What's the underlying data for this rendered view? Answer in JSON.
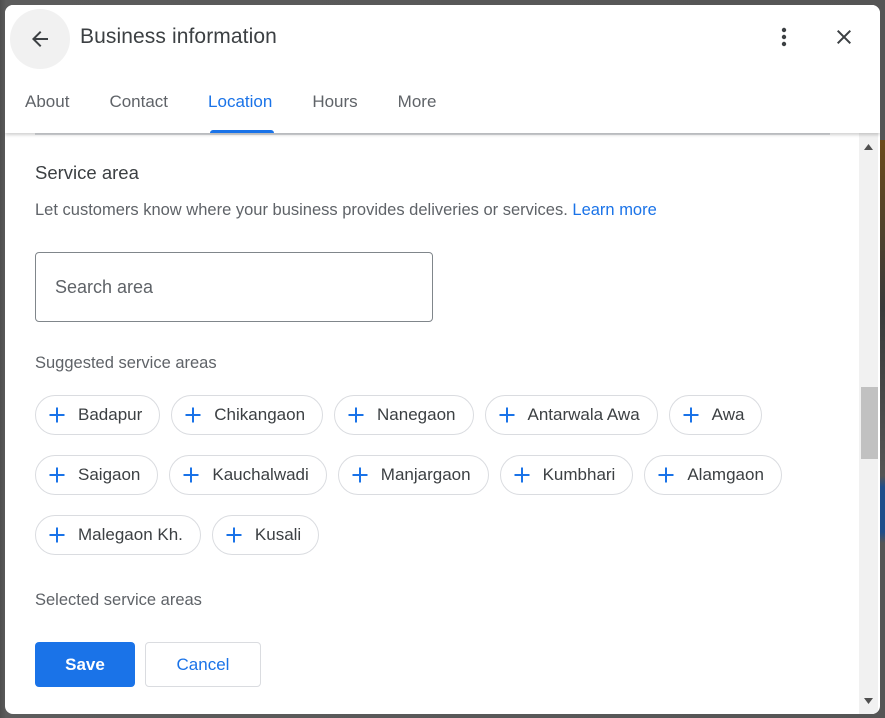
{
  "dialog": {
    "title": "Business information",
    "back_icon": "arrow-left-icon",
    "more_icon": "more-vertical-icon",
    "close_icon": "close-icon"
  },
  "tabs": [
    {
      "label": "About",
      "active": false
    },
    {
      "label": "Contact",
      "active": false
    },
    {
      "label": "Location",
      "active": true
    },
    {
      "label": "Hours",
      "active": false
    },
    {
      "label": "More",
      "active": false
    }
  ],
  "service_area": {
    "title": "Service area",
    "description": "Let customers know where your business provides deliveries or services.",
    "learn_more": "Learn more",
    "search": {
      "placeholder": "Search area",
      "value": ""
    },
    "suggested_label": "Suggested service areas",
    "suggested": [
      [
        "Badapur",
        "Chikangaon",
        "Nanegaon",
        "Antarwala Awa",
        "Awa"
      ],
      [
        "Saigaon",
        "Kauchalwadi",
        "Manjargaon",
        "Kumbhari",
        "Alamgaon"
      ],
      [
        "Malegaon Kh.",
        "Kusali"
      ]
    ],
    "chip_icon": "plus-icon",
    "selected_label": "Selected service areas",
    "selected": []
  },
  "actions": {
    "save": "Save",
    "cancel": "Cancel"
  },
  "colors": {
    "accent": "#1a73e8",
    "text": "#3c4043",
    "muted": "#5f6368",
    "border": "#dadce0"
  }
}
